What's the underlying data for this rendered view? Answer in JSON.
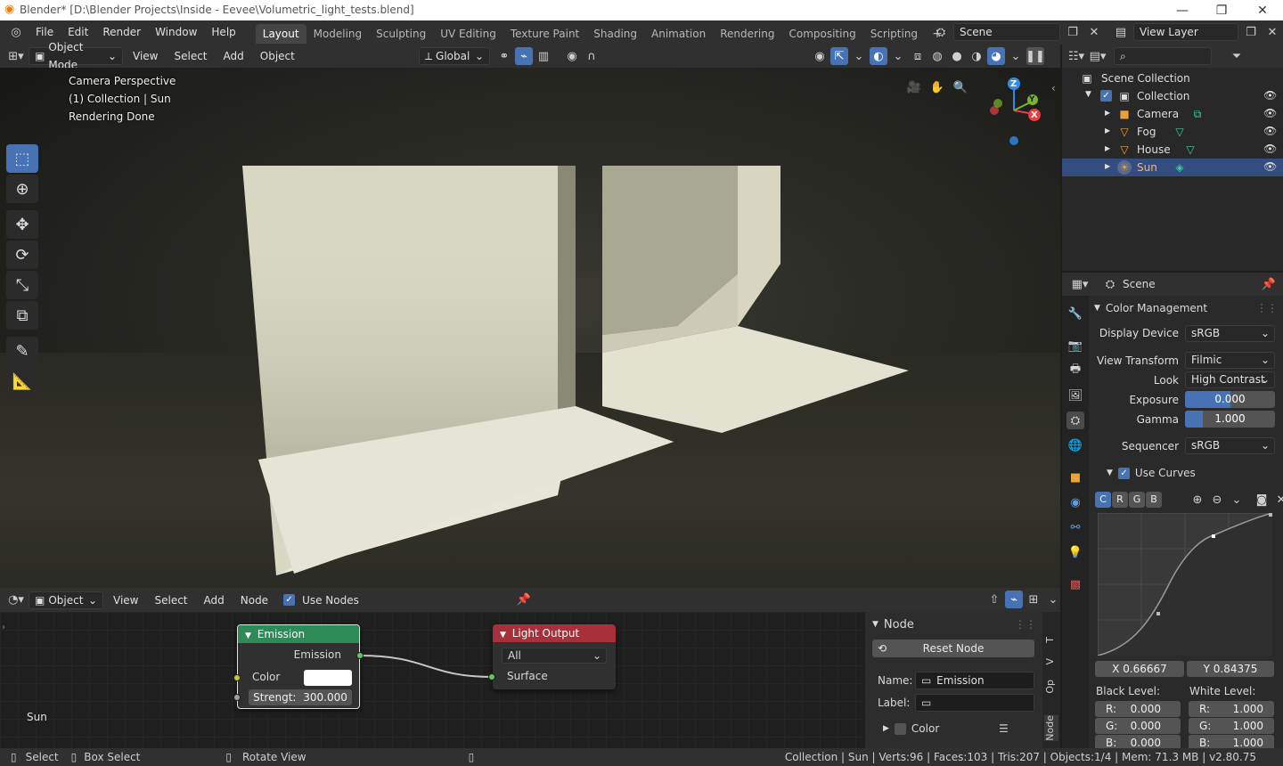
{
  "window": {
    "title": "Blender* [D:\\Blender Projects\\Inside - Eevee\\Volumetric_light_tests.blend]",
    "minimize": "—",
    "maximize": "❐",
    "close": "✕"
  },
  "menu": [
    "File",
    "Edit",
    "Render",
    "Window",
    "Help"
  ],
  "workspaces": [
    "Layout",
    "Modeling",
    "Sculpting",
    "UV Editing",
    "Texture Paint",
    "Shading",
    "Animation",
    "Rendering",
    "Compositing",
    "Scripting"
  ],
  "active_workspace": "Layout",
  "add_workspace": "+",
  "scene_selector": "Scene",
  "view_layer": "View Layer",
  "viewport_header": {
    "mode": "Object Mode",
    "menus": [
      "View",
      "Select",
      "Add",
      "Object"
    ],
    "transform_orientation": "Global"
  },
  "viewport_overlay": {
    "line1": "Camera Perspective",
    "line2": "(1) Collection | Sun",
    "line3": "Rendering Done"
  },
  "gizmo": {
    "z": "Z",
    "y": "Y",
    "x": "X"
  },
  "node_header": {
    "type": "Object",
    "menus": [
      "View",
      "Select",
      "Add",
      "Node"
    ],
    "use_nodes_label": "Use Nodes"
  },
  "nodes": {
    "emission": {
      "title": "Emission",
      "output": "Emission",
      "color_label": "Color",
      "strength_label": "Strengt:",
      "strength_value": "300.000"
    },
    "light_output": {
      "title": "Light Output",
      "target": "All",
      "input": "Surface"
    }
  },
  "node_editor_object": "Sun",
  "npanel": {
    "header": "Node",
    "reset_button": "Reset Node",
    "name_label": "Name:",
    "name_value": "Emission",
    "label_label": "Label:",
    "label_value": "",
    "color_label": "Color",
    "tabs": [
      "Node",
      "Op",
      "V",
      "T"
    ]
  },
  "status_bar": {
    "select": "Select",
    "box_select": "Box Select",
    "rotate": "Rotate View",
    "stats": "Collection | Sun | Verts:96 | Faces:103 | Tris:207 | Objects:1/4 | Mem: 71.3 MB | v2.80.75"
  },
  "outliner": {
    "root": "Scene Collection",
    "collection": "Collection",
    "items": [
      {
        "name": "Camera",
        "icon": "camera-icon",
        "color": "#e8a33c"
      },
      {
        "name": "Fog",
        "icon": "mesh-icon",
        "color": "#e8a33c"
      },
      {
        "name": "House",
        "icon": "mesh-icon",
        "color": "#e8a33c"
      },
      {
        "name": "Sun",
        "icon": "light-icon",
        "color": "#e8a33c"
      }
    ],
    "selected": "Sun"
  },
  "properties": {
    "context": "Scene",
    "panel": "Color Management",
    "display_device_label": "Display Device",
    "display_device": "sRGB",
    "view_transform_label": "View Transform",
    "view_transform": "Filmic",
    "look_label": "Look",
    "look": "High Contrast",
    "exposure_label": "Exposure",
    "exposure": "0.000",
    "exposure_fill": 0.5,
    "gamma_label": "Gamma",
    "gamma": "1.000",
    "gamma_fill": 0.2,
    "sequencer_label": "Sequencer",
    "sequencer": "sRGB",
    "use_curves_label": "Use Curves",
    "channels": [
      "C",
      "R",
      "G",
      "B"
    ],
    "curve_x": "X 0.66667",
    "curve_y": "Y 0.84375",
    "black_level_label": "Black Level:",
    "white_level_label": "White Level:",
    "black_level": {
      "r": "0.000",
      "g": "0.000",
      "b": "0.000"
    },
    "white_level": {
      "r": "1.000",
      "g": "1.000",
      "b": "1.000"
    },
    "r_label": "R:",
    "g_label": "G:",
    "b_label": "B:"
  },
  "colors": {
    "accent": "#4772b3",
    "emission_header": "#2e8b57",
    "output_header": "#a8303a"
  }
}
